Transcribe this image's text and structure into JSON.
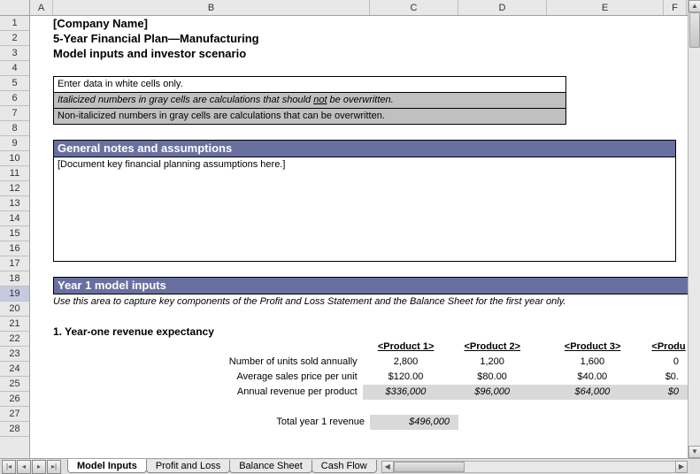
{
  "columns": [
    "A",
    "B",
    "C",
    "D",
    "E",
    "F"
  ],
  "rows": [
    "1",
    "2",
    "3",
    "4",
    "5",
    "6",
    "7",
    "8",
    "9",
    "10",
    "11",
    "12",
    "13",
    "14",
    "15",
    "16",
    "17",
    "18",
    "19",
    "20",
    "21",
    "22",
    "23",
    "24",
    "25",
    "26",
    "27",
    "28"
  ],
  "header": {
    "company": "[Company Name]",
    "title": "5-Year Financial Plan—Manufacturing",
    "subtitle": "Model inputs and investor scenario"
  },
  "info": {
    "line1": "Enter data in white cells only.",
    "line2_pre": "Italicized numbers in gray cells are calculations that should ",
    "line2_not": "not",
    "line2_post": " be overwritten.",
    "line3": "Non-italicized numbers in gray cells are calculations that can be overwritten."
  },
  "sections": {
    "notes_header": "General notes and assumptions",
    "notes_body": "[Document key financial planning assumptions here.]",
    "year1_header": "Year 1 model inputs",
    "year1_note": "Use this area to capture key components of the Profit and Loss Statement and the Balance Sheet for the first year only.",
    "revenue_head": "1. Year-one revenue expectancy"
  },
  "table": {
    "products": [
      "<Product 1>",
      "<Product 2>",
      "<Product 3>",
      "<Produ"
    ],
    "rows": [
      {
        "label": "Number of units sold annually",
        "vals": [
          "2,800",
          "1,200",
          "1,600",
          "0"
        ]
      },
      {
        "label": "Average sales price per unit",
        "vals": [
          "$120.00",
          "$80.00",
          "$40.00",
          "$0."
        ]
      },
      {
        "label": "Annual revenue per product",
        "vals": [
          "$336,000",
          "$96,000",
          "$64,000",
          "$0"
        ],
        "calc": true
      }
    ],
    "total_label": "Total year 1 revenue",
    "total_value": "$496,000"
  },
  "tabs": [
    "Model Inputs",
    "Profit and Loss",
    "Balance Sheet",
    "Cash Flow"
  ]
}
